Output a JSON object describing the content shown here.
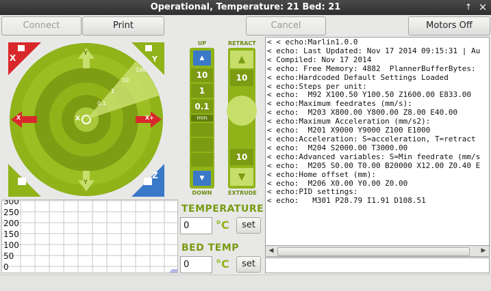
{
  "window": {
    "title": "Operational, Temperature: 21 Bed: 21",
    "btn_up": "↑",
    "btn_close": "×"
  },
  "toolbar": {
    "connect": "Connect",
    "print": "Print",
    "cancel": "Cancel",
    "motors_off": "Motors Off"
  },
  "jog": {
    "x_minus": "X",
    "x_plus": "X+",
    "y_plus": "Y",
    "y_minus": "Y",
    "home_xy": "X",
    "home_y": "Y",
    "home_x": "X",
    "home_z": "Z",
    "center": "X",
    "steps": [
      "0.1",
      "1",
      "10",
      "100"
    ]
  },
  "z_panel": {
    "up": "UP",
    "down": "DOWN",
    "buttons": [
      "10",
      "1",
      "0.1",
      "mm"
    ]
  },
  "e_panel": {
    "retract": "RETRACT",
    "extrude": "EXTRUDE",
    "top": "10",
    "bottom": "10"
  },
  "graph": {
    "y_labels": [
      "300",
      "250",
      "200",
      "150",
      "100",
      "50",
      "0"
    ]
  },
  "temperature": {
    "label": "TEMPERATURE",
    "value": "0",
    "unit": "°C",
    "set": "set"
  },
  "bed": {
    "label": "BED TEMP",
    "value": "0",
    "unit": "°C",
    "set": "set"
  },
  "console": {
    "lines": [
      "< < echo:Marlin1.0.0",
      "< echo: Last Updated: Nov 17 2014 09:15:31 | Au",
      "< Compiled: Nov 17 2014",
      "< echo: Free Memory: 4882  PlannerBufferBytes:",
      "< echo:Hardcoded Default Settings Loaded",
      "< echo:Steps per unit:",
      "< echo:  M92 X100.50 Y100.50 Z1600.00 E833.00",
      "< echo:Maximum feedrates (mm/s):",
      "< echo:  M203 X800.00 Y800.00 Z8.00 E40.00",
      "< echo:Maximum Acceleration (mm/s2):",
      "< echo:  M201 X9000 Y9000 Z100 E1000",
      "< echo:Acceleration: S=acceleration, T=retract",
      "< echo:  M204 S2000.00 T3000.00",
      "< echo:Advanced variables: S=Min feedrate (mm/s",
      "< echo:  M205 S0.00 T0.00 B20000 X12.00 Z0.40 E",
      "< echo:Home offset (mm):",
      "< echo:  M206 X0.00 Y0.00 Z0.00",
      "< echo:PID settings:",
      "< echo:   M301 P28.79 I1.91 D108.51"
    ],
    "scroll_left": "◀",
    "scroll_right": "▶"
  },
  "colors": {
    "green": "#8fb319",
    "dark_green": "#5f7d0b",
    "red": "#d9282c",
    "blue": "#3a78c8"
  }
}
